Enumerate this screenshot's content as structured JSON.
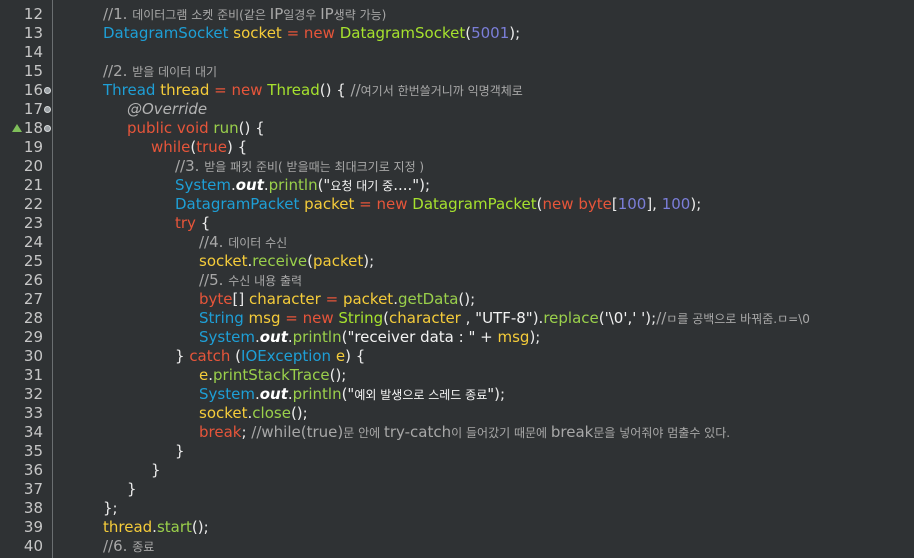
{
  "editor": {
    "colors": {
      "background": "#2f3234",
      "keyword": "#e6553a",
      "type": "#1e9fd6",
      "variable": "#f5cc3a",
      "method": "#9ad04b",
      "number": "#7b7ed8",
      "comment": "#a8a8a8"
    },
    "lines": [
      {
        "n": "12",
        "indent": 1,
        "marker": "",
        "tokens": [
          [
            "cmt",
            "//1. "
          ],
          [
            "cmt small",
            "데이터그램 소켓 준비(같은 "
          ],
          [
            "cmt",
            "IP"
          ],
          [
            "cmt small",
            "일경우 "
          ],
          [
            "cmt",
            "IP"
          ],
          [
            "cmt small",
            "생략 가능)"
          ]
        ]
      },
      {
        "n": "13",
        "indent": 1,
        "marker": "",
        "tokens": [
          [
            "typ",
            "DatagramSocket "
          ],
          [
            "var",
            "socket "
          ],
          [
            "op",
            "= "
          ],
          [
            "kw",
            "new "
          ],
          [
            "cls",
            "DatagramSocket"
          ],
          [
            "pl",
            "("
          ],
          [
            "num",
            "5001"
          ],
          [
            "pl",
            ");"
          ]
        ]
      },
      {
        "n": "14",
        "indent": 1,
        "marker": "",
        "tokens": []
      },
      {
        "n": "15",
        "indent": 1,
        "marker": "",
        "tokens": [
          [
            "cmt",
            "//2. "
          ],
          [
            "cmt small",
            "받을 데이터 대기"
          ]
        ]
      },
      {
        "n": "16",
        "indent": 1,
        "marker": "fold",
        "tokens": [
          [
            "typ",
            "Thread "
          ],
          [
            "var",
            "thread "
          ],
          [
            "op",
            "= "
          ],
          [
            "kw",
            "new "
          ],
          [
            "cls",
            "Thread"
          ],
          [
            "pl",
            "() { "
          ],
          [
            "cmt",
            "//"
          ],
          [
            "cmt small",
            "여기서 한번쓸거니까 익명객체로"
          ]
        ]
      },
      {
        "n": "17",
        "indent": 2,
        "marker": "fold",
        "tokens": [
          [
            "ann",
            "@Override"
          ]
        ]
      },
      {
        "n": "18",
        "indent": 2,
        "marker": "override",
        "tokens": [
          [
            "kw",
            "public "
          ],
          [
            "kw",
            "void "
          ],
          [
            "mtd",
            "run"
          ],
          [
            "pl",
            "() {"
          ]
        ]
      },
      {
        "n": "19",
        "indent": 3,
        "marker": "",
        "tokens": [
          [
            "kw",
            "while"
          ],
          [
            "pl",
            "("
          ],
          [
            "kw",
            "true"
          ],
          [
            "pl",
            ") {"
          ]
        ]
      },
      {
        "n": "20",
        "indent": 4,
        "marker": "",
        "tokens": [
          [
            "cmt",
            "//3. "
          ],
          [
            "cmt small",
            "받을 패킷 준비( 받을때는 최대크기로 지정 )"
          ]
        ]
      },
      {
        "n": "21",
        "indent": 4,
        "marker": "",
        "tokens": [
          [
            "typ",
            "System"
          ],
          [
            "pl",
            "."
          ],
          [
            "fld",
            "out"
          ],
          [
            "pl",
            "."
          ],
          [
            "mtd",
            "println"
          ],
          [
            "pl",
            "(\""
          ],
          [
            "str small",
            "요청 대기 중"
          ],
          [
            "str",
            "....\""
          ],
          [
            "pl",
            ");"
          ]
        ]
      },
      {
        "n": "22",
        "indent": 4,
        "marker": "",
        "tokens": [
          [
            "typ",
            "DatagramPacket "
          ],
          [
            "var",
            "packet "
          ],
          [
            "op",
            "= "
          ],
          [
            "kw",
            "new "
          ],
          [
            "cls",
            "DatagramPacket"
          ],
          [
            "pl",
            "("
          ],
          [
            "kw",
            "new "
          ],
          [
            "kw",
            "byte"
          ],
          [
            "pl",
            "["
          ],
          [
            "num",
            "100"
          ],
          [
            "pl",
            "], "
          ],
          [
            "num",
            "100"
          ],
          [
            "pl",
            ");"
          ]
        ]
      },
      {
        "n": "23",
        "indent": 4,
        "marker": "",
        "tokens": [
          [
            "kw",
            "try "
          ],
          [
            "pl",
            "{"
          ]
        ]
      },
      {
        "n": "24",
        "indent": 5,
        "marker": "",
        "tokens": [
          [
            "cmt",
            "//4. "
          ],
          [
            "cmt small",
            "데이터 수신"
          ]
        ]
      },
      {
        "n": "25",
        "indent": 5,
        "marker": "",
        "tokens": [
          [
            "var",
            "socket"
          ],
          [
            "pl",
            "."
          ],
          [
            "mtd",
            "receive"
          ],
          [
            "pl",
            "("
          ],
          [
            "var",
            "packet"
          ],
          [
            "pl",
            ");"
          ]
        ]
      },
      {
        "n": "26",
        "indent": 5,
        "marker": "",
        "tokens": [
          [
            "cmt",
            "//5. "
          ],
          [
            "cmt small",
            "수신 내용 출력"
          ]
        ]
      },
      {
        "n": "27",
        "indent": 5,
        "marker": "",
        "tokens": [
          [
            "kw",
            "byte"
          ],
          [
            "pl",
            "[] "
          ],
          [
            "var",
            "character "
          ],
          [
            "op",
            "= "
          ],
          [
            "var",
            "packet"
          ],
          [
            "pl",
            "."
          ],
          [
            "mtd",
            "getData"
          ],
          [
            "pl",
            "();"
          ]
        ]
      },
      {
        "n": "28",
        "indent": 5,
        "marker": "",
        "tokens": [
          [
            "typ",
            "String "
          ],
          [
            "var",
            "msg "
          ],
          [
            "op",
            "= "
          ],
          [
            "kw",
            "new "
          ],
          [
            "cls",
            "String"
          ],
          [
            "pl",
            "("
          ],
          [
            "var",
            "character "
          ],
          [
            "pl",
            ", "
          ],
          [
            "str",
            "\"UTF-8\""
          ],
          [
            "pl",
            ")."
          ],
          [
            "mtd",
            "replace"
          ],
          [
            "pl",
            "("
          ],
          [
            "str",
            "'\\0','"
          ],
          [
            "str",
            " '"
          ],
          [
            "pl",
            ");"
          ],
          [
            "cmt",
            "//"
          ],
          [
            "cmt small",
            "ㅁ를 공백으로 바꿔줌.ㅁ=\\0"
          ]
        ]
      },
      {
        "n": "29",
        "indent": 5,
        "marker": "",
        "tokens": [
          [
            "typ",
            "System"
          ],
          [
            "pl",
            "."
          ],
          [
            "fld",
            "out"
          ],
          [
            "pl",
            "."
          ],
          [
            "mtd",
            "println"
          ],
          [
            "pl",
            "("
          ],
          [
            "str",
            "\"receiver data : \""
          ],
          [
            "pl",
            " + "
          ],
          [
            "var",
            "msg"
          ],
          [
            "pl",
            ");"
          ]
        ]
      },
      {
        "n": "30",
        "indent": 4,
        "marker": "",
        "tokens": [
          [
            "pl",
            "} "
          ],
          [
            "kw",
            "catch "
          ],
          [
            "pl",
            "("
          ],
          [
            "typ",
            "IOException "
          ],
          [
            "var",
            "e"
          ],
          [
            "pl",
            ") {"
          ]
        ]
      },
      {
        "n": "31",
        "indent": 5,
        "marker": "",
        "tokens": [
          [
            "var",
            "e"
          ],
          [
            "pl",
            "."
          ],
          [
            "mtd",
            "printStackTrace"
          ],
          [
            "pl",
            "();"
          ]
        ]
      },
      {
        "n": "32",
        "indent": 5,
        "marker": "",
        "tokens": [
          [
            "typ",
            "System"
          ],
          [
            "pl",
            "."
          ],
          [
            "fld",
            "out"
          ],
          [
            "pl",
            "."
          ],
          [
            "mtd",
            "println"
          ],
          [
            "pl",
            "(\""
          ],
          [
            "str small",
            "예외 발생으로 스레드 종료"
          ],
          [
            "str",
            "\""
          ],
          [
            "pl",
            ");"
          ]
        ]
      },
      {
        "n": "33",
        "indent": 5,
        "marker": "",
        "tokens": [
          [
            "var",
            "socket"
          ],
          [
            "pl",
            "."
          ],
          [
            "mtd",
            "close"
          ],
          [
            "pl",
            "();"
          ]
        ]
      },
      {
        "n": "34",
        "indent": 5,
        "marker": "",
        "tokens": [
          [
            "kw",
            "break"
          ],
          [
            "pl",
            "; "
          ],
          [
            "cmt",
            "//while(true)"
          ],
          [
            "cmt small",
            "문 안에 "
          ],
          [
            "cmt",
            "try-catch"
          ],
          [
            "cmt small",
            "이 들어갔기 때문에 "
          ],
          [
            "cmt",
            "break"
          ],
          [
            "cmt small",
            "문을 넣어줘야 멈출수 있다."
          ]
        ]
      },
      {
        "n": "35",
        "indent": 4,
        "marker": "",
        "tokens": [
          [
            "pl",
            "}"
          ]
        ]
      },
      {
        "n": "36",
        "indent": 3,
        "marker": "",
        "tokens": [
          [
            "pl",
            "}"
          ]
        ]
      },
      {
        "n": "37",
        "indent": 2,
        "marker": "",
        "tokens": [
          [
            "pl",
            "}"
          ]
        ]
      },
      {
        "n": "38",
        "indent": 1,
        "marker": "",
        "tokens": [
          [
            "pl",
            "};"
          ]
        ]
      },
      {
        "n": "39",
        "indent": 1,
        "marker": "",
        "tokens": [
          [
            "var",
            "thread"
          ],
          [
            "pl",
            "."
          ],
          [
            "mtd",
            "start"
          ],
          [
            "pl",
            "();"
          ]
        ]
      },
      {
        "n": "40",
        "indent": 1,
        "marker": "",
        "tokens": [
          [
            "cmt",
            "//6. "
          ],
          [
            "cmt small",
            "종료"
          ]
        ]
      }
    ]
  }
}
